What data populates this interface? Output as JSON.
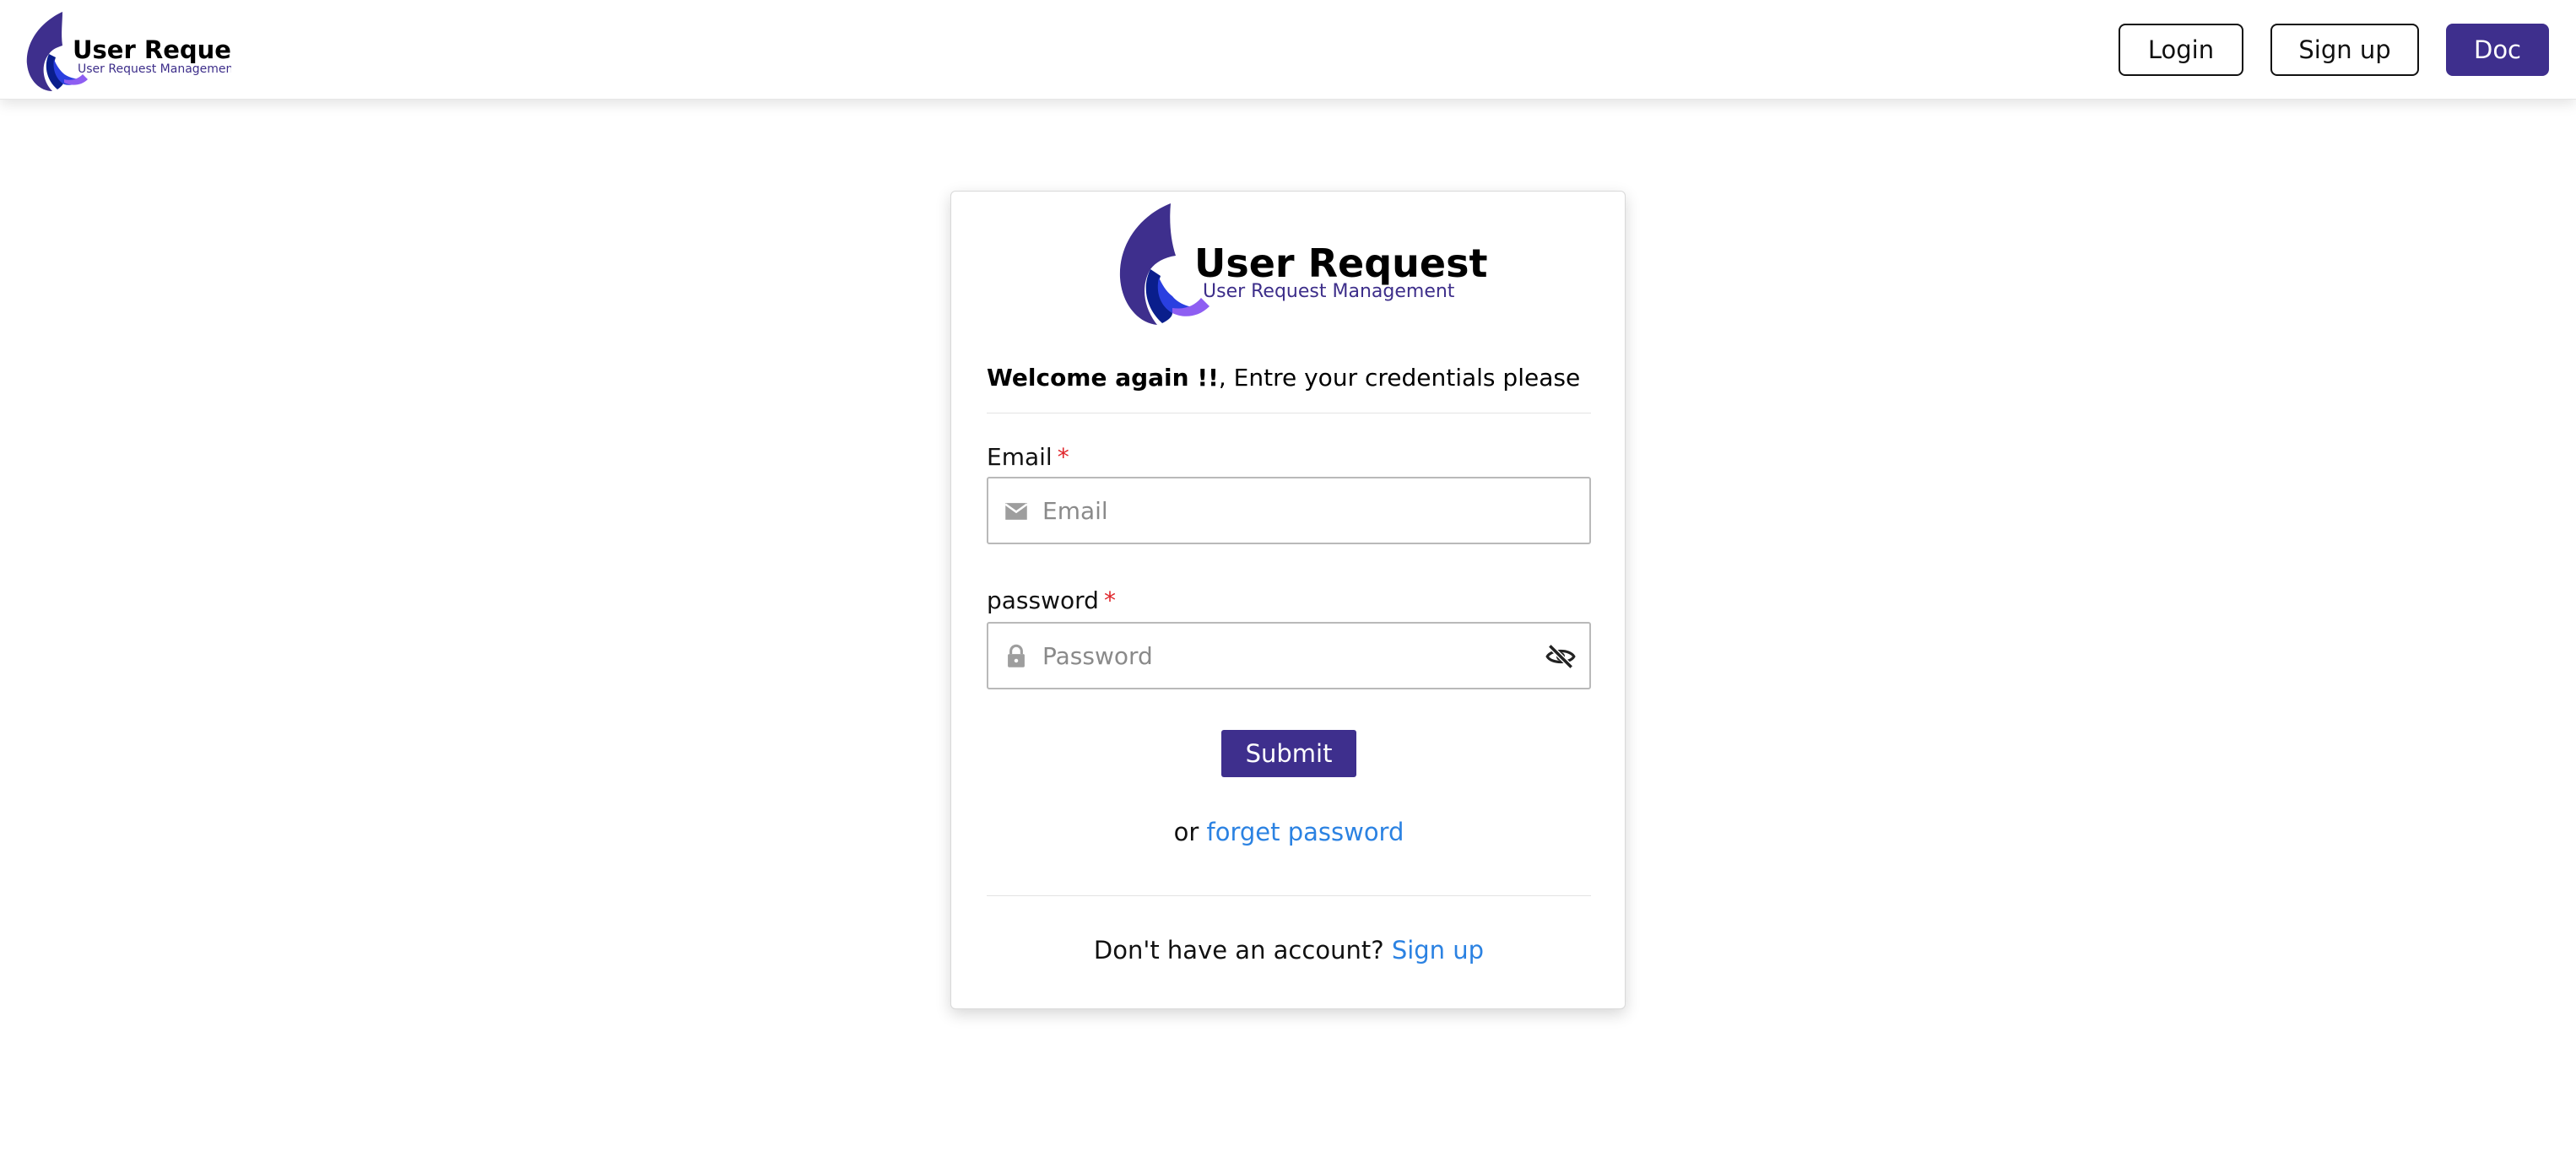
{
  "brand": {
    "title": "User Request",
    "subtitle": "User Request Management",
    "primary_color": "#3e2f8d",
    "link_color": "#2b82e2",
    "required_color": "#e0262b"
  },
  "nav": {
    "login_label": "Login",
    "signup_label": "Sign up",
    "doc_label": "Doc"
  },
  "login_card": {
    "welcome_bold": "Welcome again !!",
    "welcome_rest": ", Entre your credentials please",
    "email": {
      "label": "Email",
      "required_mark": "*",
      "placeholder": "Email",
      "value": "",
      "icon": "mail-icon"
    },
    "password": {
      "label": "password",
      "required_mark": "*",
      "placeholder": "Password",
      "value": "",
      "icon": "lock-icon",
      "toggle_icon": "eye-off-icon"
    },
    "submit_label": "Submit",
    "forgot_prefix": "or",
    "forgot_link": "forget password",
    "signup_prompt": "Don't have an account?",
    "signup_link": "Sign up"
  }
}
